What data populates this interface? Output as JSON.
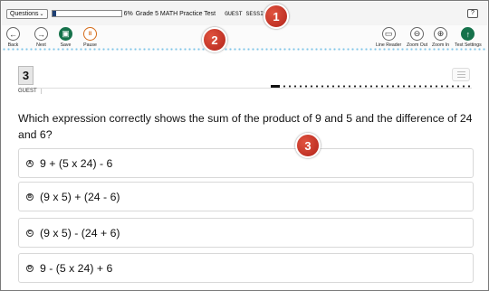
{
  "topbar": {
    "questions_label": "Questions",
    "questions_chevron": "⌄",
    "progress_fraction": 0.06,
    "progress_percent": "6%",
    "test_name": "Grade 5 MATH Practice Test",
    "session": "GUEST SESSION",
    "help_label": "?"
  },
  "toolbar": {
    "back": {
      "label": "Back",
      "icon": "arrow-left-icon",
      "glyph": "←"
    },
    "next": {
      "label": "Next",
      "icon": "arrow-right-icon",
      "glyph": "→"
    },
    "save": {
      "label": "Save",
      "icon": "save-icon",
      "glyph": "▣"
    },
    "pause": {
      "label": "Pause",
      "icon": "pause-icon",
      "glyph": "II"
    },
    "line_reader": {
      "label": "Line Reader",
      "icon": "line-reader-icon",
      "glyph": "▭"
    },
    "zoom_out": {
      "label": "Zoom Out",
      "icon": "zoom-out-icon",
      "glyph": "⊖"
    },
    "zoom_in": {
      "label": "Zoom In",
      "icon": "zoom-in-icon",
      "glyph": "⊕"
    },
    "test_settings": {
      "label": "Test Settings",
      "icon": "settings-icon",
      "glyph": "↑"
    }
  },
  "question": {
    "number": "3",
    "user_tab": "GUEST",
    "text": "Which expression correctly shows the sum of the product of 9 and 5 and the difference of 24 and 6?",
    "options": [
      {
        "letter": "A",
        "text": "9 + (5 x 24) - 6"
      },
      {
        "letter": "B",
        "text": "(9 x 5) + (24 - 6)"
      },
      {
        "letter": "C",
        "text": "(9 x 5) - (24 + 6)"
      },
      {
        "letter": "D",
        "text": "9 - (5 x 24) + 6"
      }
    ]
  },
  "callouts": [
    "1",
    "2",
    "3"
  ],
  "colors": {
    "progress": "#1d3f73",
    "save_green": "#16724b",
    "pause_orange": "#d46a17",
    "callout_red": "#c0392b",
    "dot_blue": "#7ec5e8"
  }
}
